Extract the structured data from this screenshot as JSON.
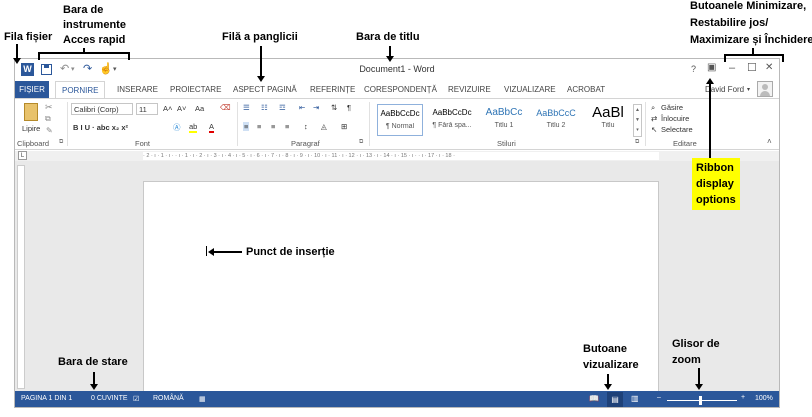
{
  "annotations": {
    "file_tab": "Fila fișier",
    "qat": [
      "Bara de",
      "instrumente",
      "Acces rapid"
    ],
    "ribbon_tab": "Filă a panglicii",
    "title_bar": "Bara de titlu",
    "window_buttons": [
      "Butoanele Minimizare,",
      "Restabilire jos/",
      "Maximizare și Închidere"
    ],
    "ribbon_display": [
      "Ribbon",
      "display",
      "options"
    ],
    "insertion_point": "Punct de inserție",
    "status_bar": "Bara de stare",
    "view_buttons": [
      "Butoane",
      "vizualizare"
    ],
    "zoom_slider": [
      "Glisor de",
      "zoom"
    ]
  },
  "window": {
    "title": "Document1 - Word",
    "user": "David Ford",
    "help": "?",
    "ribbon_options": "▣",
    "minimize": "–",
    "restore": "☐",
    "close": "✕"
  },
  "tabs": [
    "FIȘIER",
    "PORNIRE",
    "INSERARE",
    "PROIECTARE",
    "ASPECT PAGINĂ",
    "REFERINȚE",
    "CORESPONDENȚĂ",
    "REVIZUIRE",
    "VIZUALIZARE",
    "ACROBAT"
  ],
  "ribbon": {
    "clipboard": {
      "label": "Clipboard",
      "paste": "Lipire"
    },
    "font": {
      "label": "Font",
      "name": "Calibri (Corp)",
      "size": "11",
      "case": "Aa",
      "row2": "B  I  U  ·  abc  x₂  x²"
    },
    "paragraph": {
      "label": "Paragraf"
    },
    "styles": {
      "label": "Stiluri",
      "items": [
        {
          "sample": "AaBbCcDc",
          "name": "¶ Normal"
        },
        {
          "sample": "AaBbCcDc",
          "name": "¶ Fără spa..."
        },
        {
          "sample": "AaBbCc",
          "name": "Titlu 1"
        },
        {
          "sample": "AaBbCcC",
          "name": "Titlu 2"
        },
        {
          "sample": "AaBl",
          "name": "Titlu"
        }
      ]
    },
    "editing": {
      "label": "Editare",
      "find": "Găsire",
      "replace": "Înlocuire",
      "select": "Selectare"
    }
  },
  "ruler": "· 2 · ı · 1 · ı ·   · ı · 1 · ı · 2 · ı · 3 · ı · 4 · ı · 5 · ı · 6 · ı · 7 · ı · 8 · ı · 9 · ı · 10 · ı · 11 · ı · 12 · ı · 13 · ı · 14 · ı · 15 · ı ·   · ı · 17 · ı · 18 ·",
  "status": {
    "page": "PAGINA 1 DIN 1",
    "words": "0 CUVINTE",
    "language": "ROMÂNĂ",
    "zoom": "100%",
    "zoom_level": 1.0
  },
  "colors": {
    "accent": "#2b579a",
    "annotation_highlight": "#ffff00"
  }
}
